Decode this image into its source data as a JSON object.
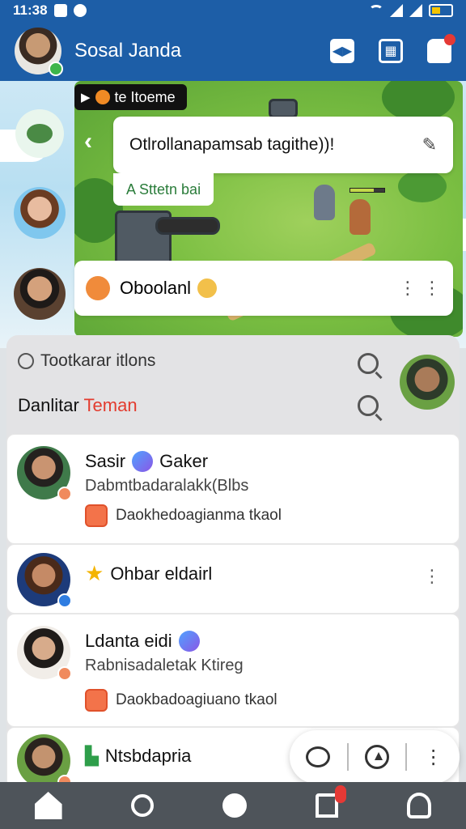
{
  "status_bar": {
    "time": "11:38"
  },
  "header": {
    "title": "Sosal Janda",
    "actions": [
      {
        "icon": "message-icon"
      },
      {
        "icon": "gallery-icon"
      },
      {
        "icon": "bell-icon"
      }
    ]
  },
  "game": {
    "tag_label": "te Itoeme",
    "bubble_text": "Otlrollanapamsab tagithe))!",
    "sub_tag": "A Sttetn bai",
    "item_label": "Oboolanl"
  },
  "panel": {
    "section_label": "Tootkarar itlons",
    "title_prefix": "Danlitar",
    "title_accent": "Teman",
    "accent_color": "#e33b2e"
  },
  "friends": [
    {
      "name": "Sasir",
      "name2": "Gaker",
      "sub": "Dabmtbadaralakk(Blbs",
      "note": "Daokhedoagianma tkaol"
    },
    {
      "name": "Ohbar eldairl"
    },
    {
      "name": "Ldanta eidi",
      "sub": "Rabnisadaletak Ktireg",
      "note": "Daokbadoagiuano tkaol"
    },
    {
      "name": "Ntsbdapria"
    }
  ],
  "colors": {
    "header_bg": "#1d5ea7",
    "nav_bg": "#4e545a"
  }
}
